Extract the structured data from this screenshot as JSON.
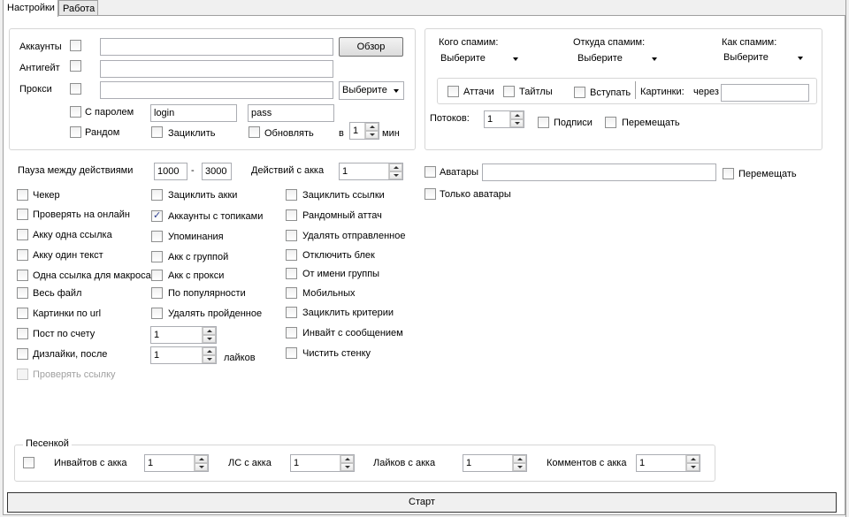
{
  "tabs": [
    {
      "label": "Настройки",
      "active": true
    },
    {
      "label": "Работа",
      "active": false
    }
  ],
  "source": {
    "accounts_label": "Аккаунты",
    "antigate_label": "Антигейт",
    "proxy_label": "Прокси",
    "browse_button": "Обзор",
    "proxy_dropdown": "Выберите",
    "with_password_label": "С паролем",
    "login_value": "login",
    "pass_value": "pass",
    "random_label": "Рандом",
    "loop_label": "Зациклить",
    "update_label": "Обновлять",
    "in_label": "в",
    "update_minutes": "1",
    "min_label": "мин"
  },
  "spam": {
    "whom_label": "Кого спамим:",
    "whom_value": "Выберите",
    "where_label": "Откуда спамим:",
    "where_value": "Выберите",
    "how_label": "Как спамим:",
    "how_value": "Выберите",
    "attach_label": "Аттачи",
    "titles_label": "Тайтлы",
    "join_label": "Вступать",
    "pictures_label": "Картинки:",
    "via_label": "через",
    "threads_label": "Потоков:",
    "threads_value": "1",
    "signatures_label": "Подписи",
    "shuffle_label": "Перемещать"
  },
  "pause": {
    "label": "Пауза между действиями",
    "from": "1000",
    "dash": "-",
    "to": "3000",
    "actions_label": "Действий с акка",
    "actions_value": "1"
  },
  "avatars": {
    "avatars_label": "Аватары",
    "shuffle_label": "Перемещать",
    "only_avatars_label": "Только аватары"
  },
  "col1": [
    {
      "label": "Чекер",
      "checked": false
    },
    {
      "label": "Проверять на онлайн",
      "checked": false
    },
    {
      "label": "Акку одна ссылка",
      "checked": false
    },
    {
      "label": "Акку один текст",
      "checked": false
    },
    {
      "label": "Одна ссылка для макроса",
      "checked": false
    },
    {
      "label": "Весь файл",
      "checked": false
    },
    {
      "label": "Картинки по url",
      "checked": false
    },
    {
      "label": "Пост по счету",
      "checked": false
    },
    {
      "label": "Дизлайки, после",
      "checked": false
    },
    {
      "label": "Проверять ссылку",
      "checked": false,
      "disabled": true
    }
  ],
  "col2": [
    {
      "label": "Зациклить акки",
      "checked": false
    },
    {
      "label": "Аккаунты с топиками",
      "checked": true
    },
    {
      "label": "Упоминания",
      "checked": false
    },
    {
      "label": "Акк с группой",
      "checked": false
    },
    {
      "label": "Акк с прокси",
      "checked": false
    },
    {
      "label": "По популярности",
      "checked": false
    },
    {
      "label": "Удалять пройденное",
      "checked": false
    }
  ],
  "col2_post_value": "1",
  "col2_dislike_value": "1",
  "col2_likes_label": "лайков",
  "col3": [
    {
      "label": "Зациклить ссылки",
      "checked": false
    },
    {
      "label": "Рандомный аттач",
      "checked": false
    },
    {
      "label": "Удалять отправленное",
      "checked": false
    },
    {
      "label": "Отключить блек",
      "checked": false
    },
    {
      "label": "От имени группы",
      "checked": false
    },
    {
      "label": "Мобильных",
      "checked": false
    },
    {
      "label": "Зациклить критерии",
      "checked": false
    },
    {
      "label": "Инвайт с сообщением",
      "checked": false
    },
    {
      "label": "Чистить стенку",
      "checked": false
    }
  ],
  "ladder": {
    "title": "Песенкой",
    "invites_label": "Инвайтов с акка",
    "invites_value": "1",
    "ls_label": "ЛС  с акка",
    "ls_value": "1",
    "likes_label": "Лайков с акка",
    "likes_value": "1",
    "comments_label": "Комментов с акка",
    "comments_value": "1"
  },
  "start_button": "Старт",
  "colors": {
    "background": "#f0f0f0",
    "panel": "#ffffff",
    "border": "#a0a0a0",
    "check": "#2a3d8f"
  }
}
